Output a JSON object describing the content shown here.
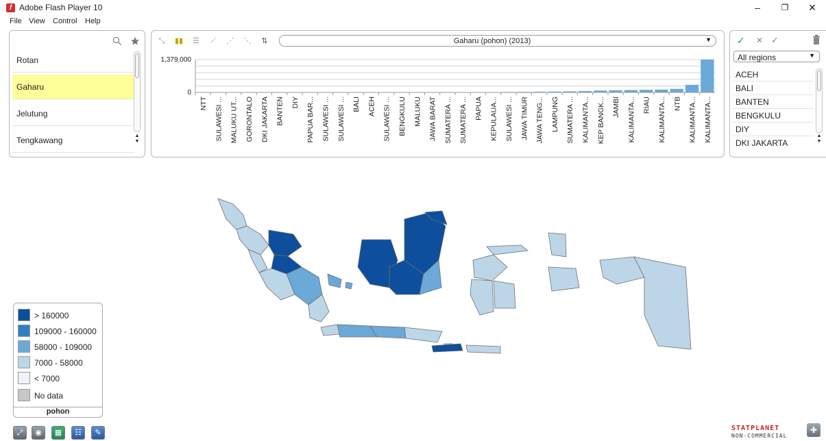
{
  "window": {
    "title": "Adobe Flash Player 10",
    "controls": [
      "–",
      "❐",
      "✕"
    ]
  },
  "menu": [
    "File",
    "View",
    "Control",
    "Help"
  ],
  "left_panel": {
    "items": [
      {
        "label": "Rotan",
        "selected": false
      },
      {
        "label": "Gaharu",
        "selected": true
      },
      {
        "label": "Jelutung",
        "selected": false
      },
      {
        "label": "Tengkawang",
        "selected": false
      }
    ]
  },
  "chart_toolbar": {
    "icons": [
      "scatter-map-icon",
      "bar-chart-icon",
      "horizontal-bar-icon",
      "line-chart-icon",
      "area-chart-icon",
      "scatter-plot-icon",
      "sort-icon"
    ],
    "indicator": "Gaharu (pohon) (2013)"
  },
  "chart_data": {
    "type": "bar",
    "title": "",
    "xlabel": "",
    "ylabel": "",
    "ylim": [
      0,
      1379000
    ],
    "y_ticks": [
      "1,379,000",
      "0"
    ],
    "categories": [
      "NTT",
      "SULAWESI ...",
      "MALUKU UT...",
      "GORONTALO",
      "DKI JAKARTA",
      "BANTEN",
      "DIY",
      "PAPUA BAR...",
      "SULAWESI ...",
      "SULAWESI ...",
      "BALI",
      "ACEH",
      "SULAWESI ...",
      "BENGKULU",
      "MALUKU",
      "JAWA BARAT",
      "SUMATERA ...",
      "SUMATERA ...",
      "PAPUA",
      "KEPULAUA...",
      "SULAWESI ...",
      "JAWA TIMUR",
      "JAWA TENG...",
      "LAMPUNG",
      "SUMATERA ...",
      "KALIMANTA...",
      "KEP BANGK...",
      "JAMBI",
      "KALIMANTA...",
      "RIAU",
      "KALIMANTA...",
      "NTB",
      "KALIMANTA...",
      "KALIMANTA..."
    ],
    "values": [
      0,
      0,
      0,
      0,
      0,
      0,
      0,
      0,
      0,
      0,
      0,
      0,
      1000,
      2000,
      3000,
      4000,
      6000,
      8000,
      12000,
      16000,
      20000,
      26000,
      32000,
      38000,
      45000,
      60000,
      80000,
      90000,
      100000,
      110000,
      120000,
      150000,
      320000,
      1379000
    ],
    "bar_color": "#6aa9d8"
  },
  "right_panel": {
    "actions": [
      "check-all-icon",
      "clear-icon",
      "select-icon",
      "delete-icon"
    ],
    "region_filter": "All regions",
    "regions": [
      "ACEH",
      "BALI",
      "BANTEN",
      "BENGKULU",
      "DIY",
      "DKI JAKARTA"
    ]
  },
  "legend": {
    "items": [
      {
        "label": "> 160000",
        "color": "#0d4f9c"
      },
      {
        "label": "109000 - 160000",
        "color": "#2f7fc1"
      },
      {
        "label": "58000 - 109000",
        "color": "#6aa9d8"
      },
      {
        "label": "7000 - 58000",
        "color": "#bcd6e8"
      },
      {
        "label": "< 7000",
        "color": "#eef3fb"
      },
      {
        "label": "No data",
        "color": "#c8c8c8"
      }
    ],
    "unit": "pohon"
  },
  "map": {
    "dark": "#0d4f9c",
    "mid": "#6aa9d8",
    "light": "#bcd6e8",
    "border": "#6f6f6f"
  },
  "bottom_bar": {
    "buttons": [
      "fullscreen-icon",
      "eye-icon",
      "map-icon",
      "table-icon",
      "notes-icon"
    ]
  },
  "brand": {
    "name": "STATPLANET",
    "tag": "NON-COMMERCIAL"
  }
}
